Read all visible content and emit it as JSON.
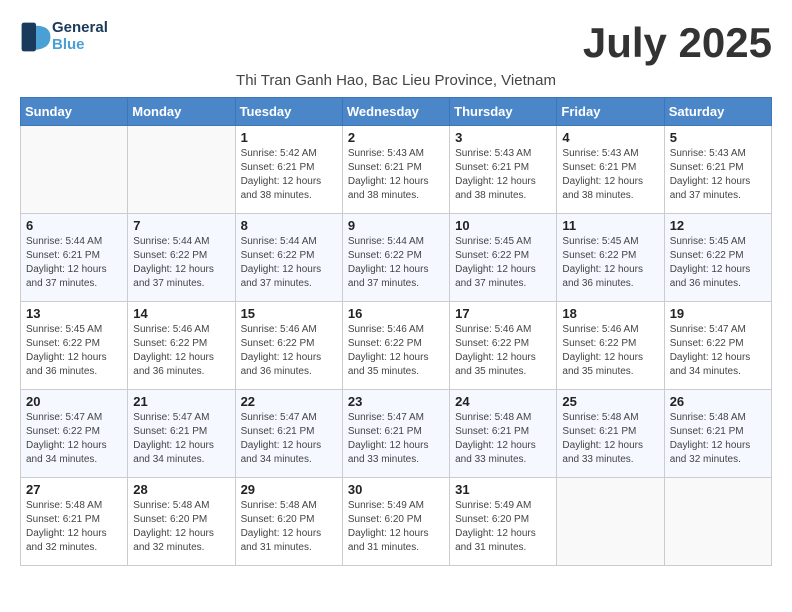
{
  "logo": {
    "text_general": "General",
    "text_blue": "Blue"
  },
  "title": "July 2025",
  "subtitle": "Thi Tran Ganh Hao, Bac Lieu Province, Vietnam",
  "days_of_week": [
    "Sunday",
    "Monday",
    "Tuesday",
    "Wednesday",
    "Thursday",
    "Friday",
    "Saturday"
  ],
  "weeks": [
    [
      {
        "day": "",
        "info": ""
      },
      {
        "day": "",
        "info": ""
      },
      {
        "day": "1",
        "info": "Sunrise: 5:42 AM\nSunset: 6:21 PM\nDaylight: 12 hours and 38 minutes."
      },
      {
        "day": "2",
        "info": "Sunrise: 5:43 AM\nSunset: 6:21 PM\nDaylight: 12 hours and 38 minutes."
      },
      {
        "day": "3",
        "info": "Sunrise: 5:43 AM\nSunset: 6:21 PM\nDaylight: 12 hours and 38 minutes."
      },
      {
        "day": "4",
        "info": "Sunrise: 5:43 AM\nSunset: 6:21 PM\nDaylight: 12 hours and 38 minutes."
      },
      {
        "day": "5",
        "info": "Sunrise: 5:43 AM\nSunset: 6:21 PM\nDaylight: 12 hours and 37 minutes."
      }
    ],
    [
      {
        "day": "6",
        "info": "Sunrise: 5:44 AM\nSunset: 6:21 PM\nDaylight: 12 hours and 37 minutes."
      },
      {
        "day": "7",
        "info": "Sunrise: 5:44 AM\nSunset: 6:22 PM\nDaylight: 12 hours and 37 minutes."
      },
      {
        "day": "8",
        "info": "Sunrise: 5:44 AM\nSunset: 6:22 PM\nDaylight: 12 hours and 37 minutes."
      },
      {
        "day": "9",
        "info": "Sunrise: 5:44 AM\nSunset: 6:22 PM\nDaylight: 12 hours and 37 minutes."
      },
      {
        "day": "10",
        "info": "Sunrise: 5:45 AM\nSunset: 6:22 PM\nDaylight: 12 hours and 37 minutes."
      },
      {
        "day": "11",
        "info": "Sunrise: 5:45 AM\nSunset: 6:22 PM\nDaylight: 12 hours and 36 minutes."
      },
      {
        "day": "12",
        "info": "Sunrise: 5:45 AM\nSunset: 6:22 PM\nDaylight: 12 hours and 36 minutes."
      }
    ],
    [
      {
        "day": "13",
        "info": "Sunrise: 5:45 AM\nSunset: 6:22 PM\nDaylight: 12 hours and 36 minutes."
      },
      {
        "day": "14",
        "info": "Sunrise: 5:46 AM\nSunset: 6:22 PM\nDaylight: 12 hours and 36 minutes."
      },
      {
        "day": "15",
        "info": "Sunrise: 5:46 AM\nSunset: 6:22 PM\nDaylight: 12 hours and 36 minutes."
      },
      {
        "day": "16",
        "info": "Sunrise: 5:46 AM\nSunset: 6:22 PM\nDaylight: 12 hours and 35 minutes."
      },
      {
        "day": "17",
        "info": "Sunrise: 5:46 AM\nSunset: 6:22 PM\nDaylight: 12 hours and 35 minutes."
      },
      {
        "day": "18",
        "info": "Sunrise: 5:46 AM\nSunset: 6:22 PM\nDaylight: 12 hours and 35 minutes."
      },
      {
        "day": "19",
        "info": "Sunrise: 5:47 AM\nSunset: 6:22 PM\nDaylight: 12 hours and 34 minutes."
      }
    ],
    [
      {
        "day": "20",
        "info": "Sunrise: 5:47 AM\nSunset: 6:22 PM\nDaylight: 12 hours and 34 minutes."
      },
      {
        "day": "21",
        "info": "Sunrise: 5:47 AM\nSunset: 6:21 PM\nDaylight: 12 hours and 34 minutes."
      },
      {
        "day": "22",
        "info": "Sunrise: 5:47 AM\nSunset: 6:21 PM\nDaylight: 12 hours and 34 minutes."
      },
      {
        "day": "23",
        "info": "Sunrise: 5:47 AM\nSunset: 6:21 PM\nDaylight: 12 hours and 33 minutes."
      },
      {
        "day": "24",
        "info": "Sunrise: 5:48 AM\nSunset: 6:21 PM\nDaylight: 12 hours and 33 minutes."
      },
      {
        "day": "25",
        "info": "Sunrise: 5:48 AM\nSunset: 6:21 PM\nDaylight: 12 hours and 33 minutes."
      },
      {
        "day": "26",
        "info": "Sunrise: 5:48 AM\nSunset: 6:21 PM\nDaylight: 12 hours and 32 minutes."
      }
    ],
    [
      {
        "day": "27",
        "info": "Sunrise: 5:48 AM\nSunset: 6:21 PM\nDaylight: 12 hours and 32 minutes."
      },
      {
        "day": "28",
        "info": "Sunrise: 5:48 AM\nSunset: 6:20 PM\nDaylight: 12 hours and 32 minutes."
      },
      {
        "day": "29",
        "info": "Sunrise: 5:48 AM\nSunset: 6:20 PM\nDaylight: 12 hours and 31 minutes."
      },
      {
        "day": "30",
        "info": "Sunrise: 5:49 AM\nSunset: 6:20 PM\nDaylight: 12 hours and 31 minutes."
      },
      {
        "day": "31",
        "info": "Sunrise: 5:49 AM\nSunset: 6:20 PM\nDaylight: 12 hours and 31 minutes."
      },
      {
        "day": "",
        "info": ""
      },
      {
        "day": "",
        "info": ""
      }
    ]
  ]
}
